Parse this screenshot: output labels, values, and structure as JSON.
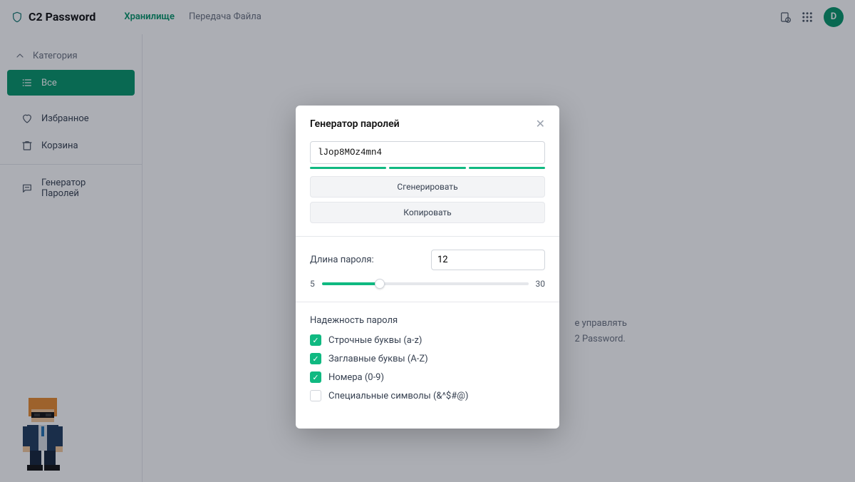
{
  "header": {
    "app_title": "C2 Password",
    "nav": {
      "vault": "Хранилище",
      "file_transfer": "Передача Файла"
    },
    "avatar_initial": "D"
  },
  "sidebar": {
    "category_label": "Категория",
    "all": "Все",
    "favorites": "Избранное",
    "trash": "Корзина",
    "generator": "Генератор Паролей"
  },
  "background": {
    "line1": "е управлять",
    "line2": "2 Password."
  },
  "modal": {
    "title": "Генератор паролей",
    "password_value": "lJop8MOz4mn4",
    "generate_btn": "Сгенерировать",
    "copy_btn": "Копировать",
    "length_label": "Длина пароля:",
    "length_value": "12",
    "slider_min": "5",
    "slider_max": "30",
    "strength_title": "Надежность пароля",
    "options": {
      "lowercase": {
        "label": "Строчные буквы (a-z)",
        "checked": true
      },
      "uppercase": {
        "label": "Заглавные буквы (A-Z)",
        "checked": true
      },
      "numbers": {
        "label": "Номера (0-9)",
        "checked": true
      },
      "special": {
        "label": "Специальные символы (&^$#@)",
        "checked": false
      }
    }
  }
}
